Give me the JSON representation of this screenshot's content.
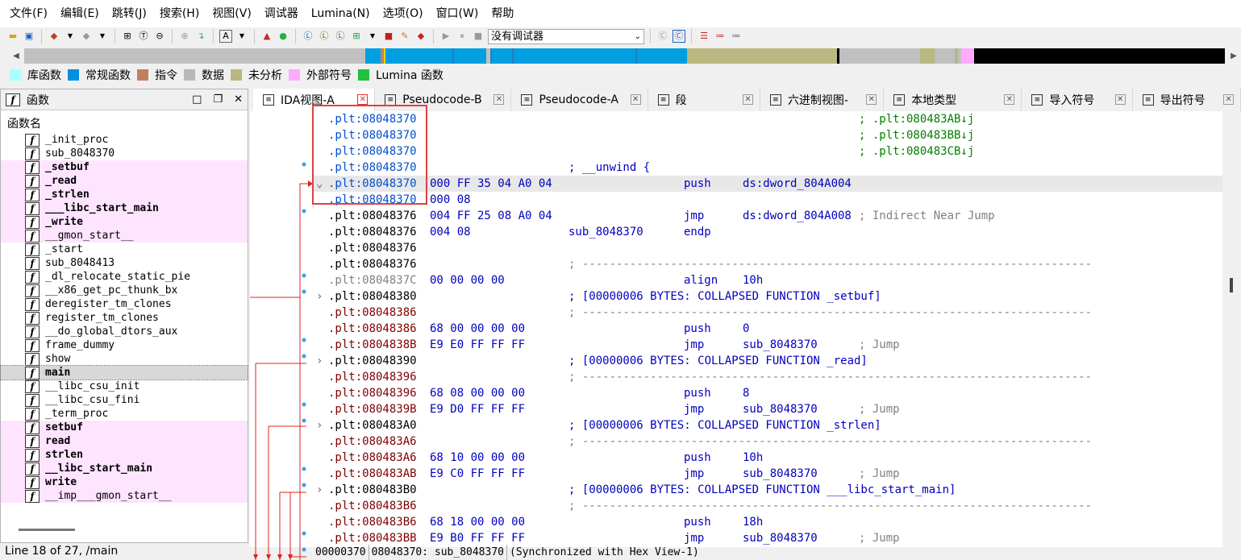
{
  "menu": [
    "文件(F)",
    "编辑(E)",
    "跳转(J)",
    "搜索(H)",
    "视图(V)",
    "调试器",
    "Lumina(N)",
    "选项(O)",
    "窗口(W)",
    "帮助"
  ],
  "toolbar": {
    "debugger_select": "没有调试器"
  },
  "colors": {
    "lib": "#aaffff",
    "regular": "#00a0e0",
    "instr": "#c08060",
    "data": "#b8b8b8",
    "unexplored": "#b8b880",
    "external": "#ffaaff",
    "lumina": "#20c040",
    "red": "#e02020"
  },
  "legend": [
    {
      "label": "库函数",
      "color": "#aaffff"
    },
    {
      "label": "常规函数",
      "color": "#0090e0"
    },
    {
      "label": "指令",
      "color": "#c08060"
    },
    {
      "label": "数据",
      "color": "#b8b8b8"
    },
    {
      "label": "未分析",
      "color": "#b8b880"
    },
    {
      "label": "外部符号",
      "color": "#ffaaff"
    },
    {
      "label": "Lumina 函数",
      "color": "#20c040"
    }
  ],
  "functions_panel": {
    "title": "函数",
    "column_header": "函数名",
    "items": [
      {
        "name": "_init_proc",
        "bold": false,
        "pink": false
      },
      {
        "name": "sub_8048370",
        "bold": false,
        "pink": false
      },
      {
        "name": "_setbuf",
        "bold": true,
        "pink": true
      },
      {
        "name": "_read",
        "bold": true,
        "pink": true
      },
      {
        "name": "_strlen",
        "bold": true,
        "pink": true
      },
      {
        "name": "___libc_start_main",
        "bold": true,
        "pink": true
      },
      {
        "name": "_write",
        "bold": true,
        "pink": true
      },
      {
        "name": "__gmon_start__",
        "bold": false,
        "pink": true
      },
      {
        "name": "_start",
        "bold": false,
        "pink": false
      },
      {
        "name": "sub_8048413",
        "bold": false,
        "pink": false
      },
      {
        "name": "_dl_relocate_static_pie",
        "bold": false,
        "pink": false
      },
      {
        "name": "__x86_get_pc_thunk_bx",
        "bold": false,
        "pink": false
      },
      {
        "name": "deregister_tm_clones",
        "bold": false,
        "pink": false
      },
      {
        "name": "register_tm_clones",
        "bold": false,
        "pink": false
      },
      {
        "name": "__do_global_dtors_aux",
        "bold": false,
        "pink": false
      },
      {
        "name": "frame_dummy",
        "bold": false,
        "pink": false
      },
      {
        "name": "show",
        "bold": false,
        "pink": false
      },
      {
        "name": "main",
        "bold": true,
        "pink": false,
        "selected": true
      },
      {
        "name": "__libc_csu_init",
        "bold": false,
        "pink": false
      },
      {
        "name": "__libc_csu_fini",
        "bold": false,
        "pink": false
      },
      {
        "name": "_term_proc",
        "bold": false,
        "pink": false
      },
      {
        "name": "setbuf",
        "bold": true,
        "pink": true
      },
      {
        "name": "read",
        "bold": true,
        "pink": true
      },
      {
        "name": "strlen",
        "bold": true,
        "pink": true
      },
      {
        "name": "__libc_start_main",
        "bold": true,
        "pink": true
      },
      {
        "name": "write",
        "bold": true,
        "pink": true
      },
      {
        "name": "__imp___gmon_start__",
        "bold": false,
        "pink": true
      }
    ],
    "status": "Line 18 of 27, /main"
  },
  "tabs": [
    {
      "label": "IDA视图-A",
      "active": true
    },
    {
      "label": "Pseudocode-B",
      "active": false
    },
    {
      "label": "Pseudocode-A",
      "active": false
    },
    {
      "label": "段",
      "active": false
    },
    {
      "label": "六进制视图-",
      "active": false
    },
    {
      "label": "本地类型",
      "active": false
    },
    {
      "label": "导入符号",
      "active": false
    },
    {
      "label": "导出符号",
      "active": false
    }
  ],
  "code_lines": [
    {
      "addr": ".plt:08048370",
      "addrColor": "#0050d0",
      "comment": "; .plt:080483AB↓j",
      "commentColor": "#008000",
      "commentX": 677
    },
    {
      "addr": ".plt:08048370",
      "addrColor": "#0050d0",
      "comment": "; .plt:080483BB↓j",
      "commentColor": "#008000",
      "commentX": 677
    },
    {
      "addr": ".plt:08048370",
      "addrColor": "#0050d0",
      "comment": "; .plt:080483CB↓j",
      "commentColor": "#008000",
      "commentX": 677
    },
    {
      "addr": ".plt:08048370",
      "addrColor": "#0050d0",
      "label": "; __unwind {",
      "labelColor": "#0000c0"
    },
    {
      "addr": ".plt:08048370",
      "addrColor": "#0050d0",
      "bytes": "000 FF 35 04 A0 04",
      "mnem": "push",
      "ops": "ds:dword_804A004",
      "highlight": true,
      "fold": "v"
    },
    {
      "addr": ".plt:08048370",
      "addrColor": "#0050d0",
      "bytes": "000 08"
    },
    {
      "addr": ".plt:08048376",
      "addrColor": "#000000",
      "bytes": "004 FF 25 08 A0 04",
      "mnem": "jmp",
      "ops": "ds:dword_804A008",
      "comment": "; Indirect Near Jump",
      "commentColor": "#808080",
      "commentX": 677
    },
    {
      "addr": ".plt:08048376",
      "addrColor": "#000000",
      "bytes": "004 08",
      "label": "sub_8048370",
      "labelColor": "#0000c0",
      "mnem": "endp"
    },
    {
      "addr": ".plt:08048376",
      "addrColor": "#000000"
    },
    {
      "addr": ".plt:08048376",
      "addrColor": "#000000",
      "label": "; ---------------------------------------------------------------------------",
      "labelColor": "#808080"
    },
    {
      "addr": ".plt:0804837C",
      "addrColor": "#808080",
      "bytes": "00 00 00 00",
      "mnem": "align",
      "ops": "10h"
    },
    {
      "addr": ".plt:08048380",
      "addrColor": "#000000",
      "label": "; [00000006 BYTES: COLLAPSED FUNCTION _setbuf]",
      "labelColor": "#0000c0",
      "fold": ">"
    },
    {
      "addr": ".plt:08048386",
      "addrColor": "#800000",
      "label": "; ---------------------------------------------------------------------------",
      "labelColor": "#808080"
    },
    {
      "addr": ".plt:08048386",
      "addrColor": "#800000",
      "bytes": "68 00 00 00 00",
      "mnem": "push",
      "ops": "0"
    },
    {
      "addr": ".plt:0804838B",
      "addrColor": "#800000",
      "bytes": "E9 E0 FF FF FF",
      "mnem": "jmp",
      "ops": "sub_8048370",
      "comment": "; Jump",
      "commentColor": "#808080",
      "commentX": 677
    },
    {
      "addr": ".plt:08048390",
      "addrColor": "#000000",
      "label": "; [00000006 BYTES: COLLAPSED FUNCTION _read]",
      "labelColor": "#0000c0",
      "fold": ">"
    },
    {
      "addr": ".plt:08048396",
      "addrColor": "#800000",
      "label": "; ---------------------------------------------------------------------------",
      "labelColor": "#808080"
    },
    {
      "addr": ".plt:08048396",
      "addrColor": "#800000",
      "bytes": "68 08 00 00 00",
      "mnem": "push",
      "ops": "8"
    },
    {
      "addr": ".plt:0804839B",
      "addrColor": "#800000",
      "bytes": "E9 D0 FF FF FF",
      "mnem": "jmp",
      "ops": "sub_8048370",
      "comment": "; Jump",
      "commentColor": "#808080",
      "commentX": 677
    },
    {
      "addr": ".plt:080483A0",
      "addrColor": "#000000",
      "label": "; [00000006 BYTES: COLLAPSED FUNCTION _strlen]",
      "labelColor": "#0000c0",
      "fold": ">"
    },
    {
      "addr": ".plt:080483A6",
      "addrColor": "#800000",
      "label": "; ---------------------------------------------------------------------------",
      "labelColor": "#808080"
    },
    {
      "addr": ".plt:080483A6",
      "addrColor": "#800000",
      "bytes": "68 10 00 00 00",
      "mnem": "push",
      "ops": "10h"
    },
    {
      "addr": ".plt:080483AB",
      "addrColor": "#800000",
      "bytes": "E9 C0 FF FF FF",
      "mnem": "jmp",
      "ops": "sub_8048370",
      "comment": "; Jump",
      "commentColor": "#808080",
      "commentX": 677
    },
    {
      "addr": ".plt:080483B0",
      "addrColor": "#000000",
      "label": "; [00000006 BYTES: COLLAPSED FUNCTION ___libc_start_main]",
      "labelColor": "#0000c0",
      "fold": ">"
    },
    {
      "addr": ".plt:080483B6",
      "addrColor": "#800000",
      "label": "; ---------------------------------------------------------------------------",
      "labelColor": "#808080"
    },
    {
      "addr": ".plt:080483B6",
      "addrColor": "#800000",
      "bytes": "68 18 00 00 00",
      "mnem": "push",
      "ops": "18h"
    },
    {
      "addr": ".plt:080483BB",
      "addrColor": "#800000",
      "bytes": "E9 B0 FF FF FF",
      "mnem": "jmp",
      "ops": "sub_8048370",
      "comment": "; Jump",
      "commentColor": "#808080",
      "commentX": 677
    }
  ],
  "bottom_status": [
    "00000370",
    "08048370: sub_8048370",
    "(Synchronized with Hex View-1)"
  ]
}
